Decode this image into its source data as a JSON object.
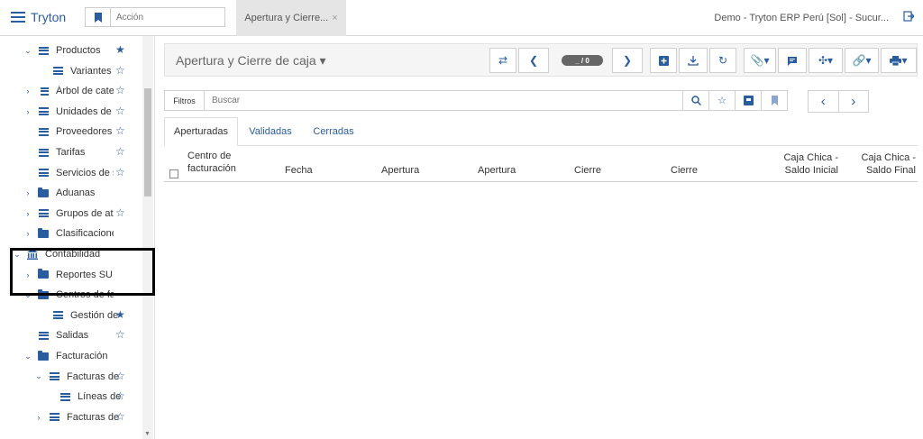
{
  "app": {
    "title": "Tryton"
  },
  "action": {
    "placeholder": "Acción"
  },
  "open_tab": {
    "label": "Apertura y Cierre...",
    "close": "×"
  },
  "company": "Demo - Tryton ERP Perú [Sol] - Sucur...",
  "sidebar": {
    "items": [
      {
        "label": "Productos",
        "icon": "list-icon",
        "chevron": "down",
        "starred": true
      },
      {
        "label": "Variantes",
        "icon": "list-icon",
        "chevron": "",
        "starred": false
      },
      {
        "label": "Árbol de categ",
        "icon": "tree-icon",
        "chevron": "right",
        "starred": false
      },
      {
        "label": "Unidades de m",
        "icon": "list-icon",
        "chevron": "right",
        "starred": false
      },
      {
        "label": "Proveedores",
        "icon": "list-icon",
        "chevron": "",
        "starred": false
      },
      {
        "label": "Tarifas",
        "icon": "list-icon",
        "chevron": "",
        "starred": false
      },
      {
        "label": "Servicios de s",
        "icon": "list-icon",
        "chevron": "",
        "starred": false
      },
      {
        "label": "Aduanas",
        "icon": "folder-icon",
        "chevron": "right",
        "starred": null
      },
      {
        "label": "Grupos de atri",
        "icon": "list-icon",
        "chevron": "right",
        "starred": false
      },
      {
        "label": "Clasificaciones",
        "icon": "folder-icon",
        "chevron": "right",
        "starred": null
      },
      {
        "label": "Contabilidad",
        "icon": "bank-icon",
        "chevron": "down",
        "starred": null
      },
      {
        "label": "Reportes SUI",
        "icon": "folder-icon",
        "chevron": "right",
        "starred": null
      },
      {
        "label": "Centros de fa",
        "icon": "folder-icon",
        "chevron": "down",
        "starred": null
      },
      {
        "label": "Gestión de",
        "icon": "list-icon",
        "chevron": "",
        "starred": true
      },
      {
        "label": "Salidas",
        "icon": "list-icon",
        "chevron": "",
        "starred": false
      },
      {
        "label": "Facturación",
        "icon": "folder-icon",
        "chevron": "down",
        "starred": null
      },
      {
        "label": "Facturas de",
        "icon": "list-icon",
        "chevron": "down",
        "starred": false
      },
      {
        "label": "Líneas de",
        "icon": "list-icon",
        "chevron": "",
        "starred": false
      },
      {
        "label": "Facturas de",
        "icon": "list-icon",
        "chevron": "right",
        "starred": false
      }
    ]
  },
  "form": {
    "title": "Apertura y Cierre de caja",
    "counter": "_ / 0"
  },
  "filter": {
    "filters_label": "Filtros",
    "search_placeholder": "Buscar"
  },
  "tabs": [
    "Aperturadas",
    "Validadas",
    "Cerradas"
  ],
  "columns": [
    {
      "line1": "Centro de",
      "line2": "facturación"
    },
    {
      "line1": "",
      "line2": "Fecha"
    },
    {
      "line1": "",
      "line2": "Apertura"
    },
    {
      "line1": "",
      "line2": "Apertura"
    },
    {
      "line1": "",
      "line2": "Cierre"
    },
    {
      "line1": "",
      "line2": "Cierre"
    },
    {
      "line1": "Caja Chica -",
      "line2": "Saldo Inicial"
    },
    {
      "line1": "Caja Chica -",
      "line2": "Saldo Final"
    }
  ]
}
